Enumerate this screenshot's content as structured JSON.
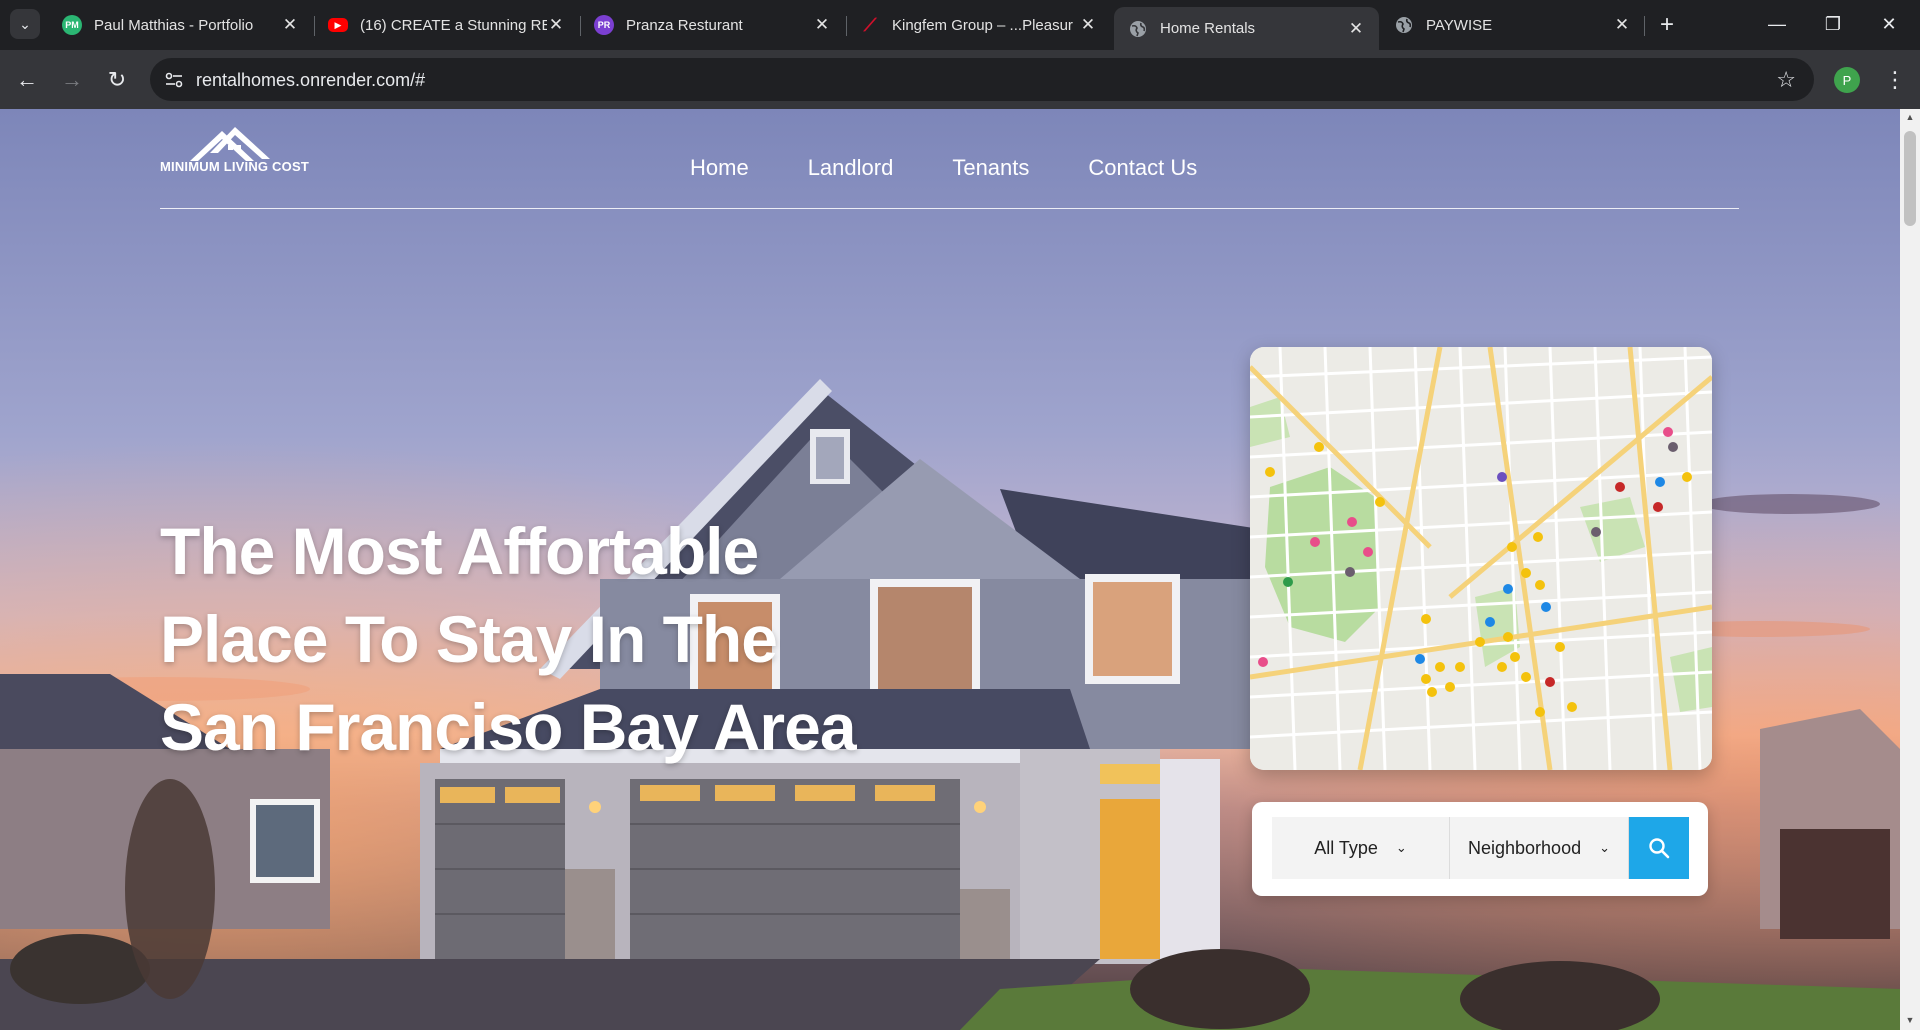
{
  "browser": {
    "tabs": [
      {
        "title": "Paul Matthias - Portfolio",
        "favicon_text": "PM",
        "favicon_color": "#2bb673",
        "active": false
      },
      {
        "title": "(16) CREATE a Stunning RE",
        "favicon_text": "",
        "favicon_color": "#ff0000",
        "active": false
      },
      {
        "title": "Pranza Resturant",
        "favicon_text": "PR",
        "favicon_color": "#7b3fd1",
        "active": false
      },
      {
        "title": "Kingfem Group – ...Pleasur",
        "favicon_text": "",
        "favicon_color": "#d0102b",
        "active": false
      },
      {
        "title": "Home Rentals",
        "favicon_text": "",
        "favicon_color": "#9aa0a6",
        "active": true
      },
      {
        "title": "PAYWISE",
        "favicon_text": "",
        "favicon_color": "#9aa0a6",
        "active": false
      }
    ],
    "url": "rentalhomes.onrender.com/#",
    "profile_initial": "P",
    "profile_color": "#3fa34d"
  },
  "site": {
    "logo_text": "MINIMUM LIVING COST",
    "nav": [
      "Home",
      "Landlord",
      "Tenants",
      "Contact Us"
    ],
    "hero_lines": [
      "The Most Affortable",
      "Place To Stay In The",
      "San Franciso Bay Area"
    ],
    "search": {
      "type_value": "All Type",
      "neighborhood_value": "Neighborhood",
      "button_icon": "search-icon",
      "button_color": "#1ea7e8"
    }
  }
}
